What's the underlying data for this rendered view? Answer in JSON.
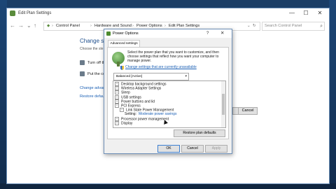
{
  "window": {
    "title": "Edit Plan Settings",
    "controls": [
      "—",
      "☐",
      "✕"
    ]
  },
  "address": {
    "crumbs": [
      "Control Panel",
      "Hardware and Sound",
      "Power Options",
      "Edit Plan Settings"
    ],
    "search_placeholder": "Search Control Panel"
  },
  "background": {
    "heading": "Change sett",
    "subheading": "Choose the sle",
    "row1": "Turn off th",
    "row2": "Put the co",
    "link1": "Change advan",
    "link2": "Restore defaul",
    "cancel_label": "Cancel"
  },
  "dialog": {
    "title": "Power Options",
    "help": "?",
    "close": "✕",
    "tab": "Advanced settings",
    "description": "Select the power plan that you want to customize, and then choose settings that reflect how you want your computer to manage power.",
    "change_link": "Change settings that are currently unavailable",
    "plan_select": "Balanced [Active]",
    "tree": [
      {
        "label": "Desktop background settings",
        "indent": 0,
        "expander": "+"
      },
      {
        "label": "Wireless Adapter Settings",
        "indent": 0,
        "expander": "+"
      },
      {
        "label": "Sleep",
        "indent": 0,
        "expander": "+"
      },
      {
        "label": "USB settings",
        "indent": 0,
        "expander": "+"
      },
      {
        "label": "Power buttons and lid",
        "indent": 0,
        "expander": "+"
      },
      {
        "label": "PCI Express",
        "indent": 0,
        "expander": "−"
      },
      {
        "label": "Link State Power Management",
        "indent": 1,
        "expander": "−"
      },
      {
        "label": "Setting:",
        "value": "Moderate power savings",
        "indent": 2,
        "expander": ""
      },
      {
        "label": "Processor power management",
        "indent": 0,
        "expander": "+"
      },
      {
        "label": "Display",
        "indent": 0,
        "expander": "+"
      }
    ],
    "restore_label": "Restore plan defaults",
    "ok_label": "OK",
    "cancel_label": "Cancel",
    "apply_label": "Apply"
  },
  "colors": {
    "desktop": "#1a3d66",
    "link": "#1a5fb4",
    "accent": "#3c7fd0"
  }
}
